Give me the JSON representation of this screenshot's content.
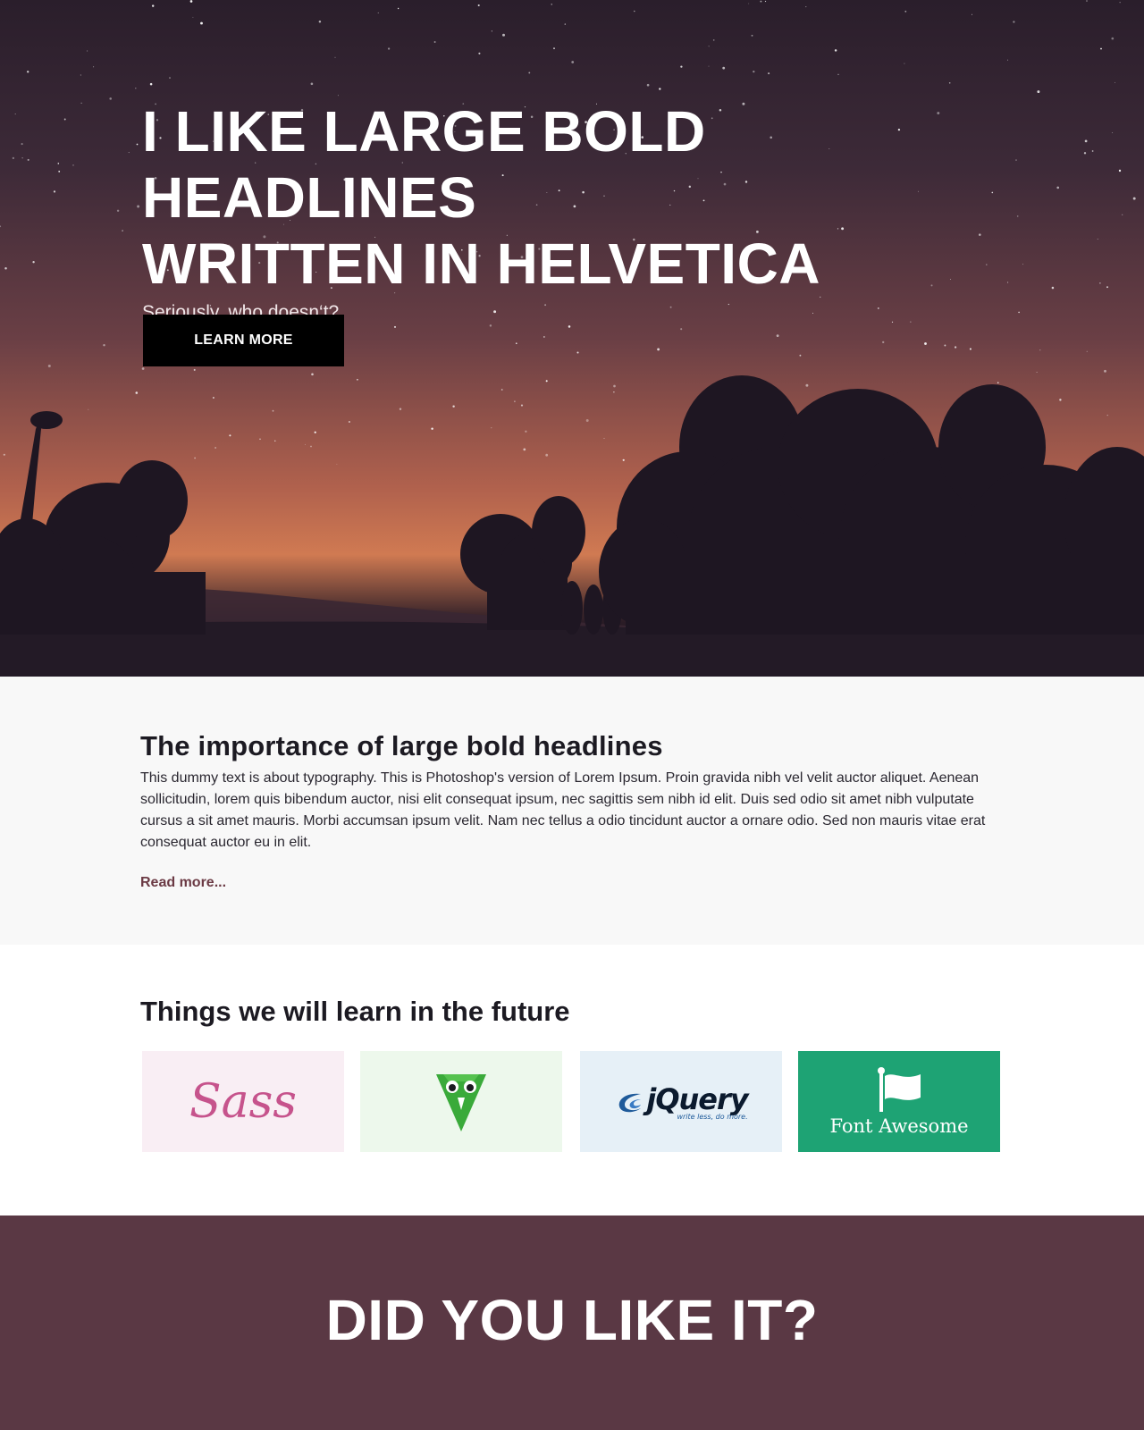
{
  "hero": {
    "title_line1": "I LIKE LARGE BOLD HEADLINES",
    "title_line2": "WRITTEN IN HELVETICA",
    "subtitle": "Seriously, who doesn‘t?",
    "button_label": "LEARN MORE"
  },
  "article": {
    "heading": "The importance of large bold headlines",
    "body": "This dummy text is about typography. This is Photoshop's version  of Lorem Ipsum. Proin gravida nibh vel velit auctor aliquet. Aenean sollicitudin, lorem quis bibendum auctor, nisi elit consequat ipsum, nec sagittis sem nibh id elit. Duis sed odio sit amet nibh vulputate cursus a sit amet mauris. Morbi accumsan ipsum velit. Nam nec tellus a odio tincidunt auctor a ornare odio. Sed non  mauris vitae erat consequat auctor eu in elit.",
    "read_more": "Read more..."
  },
  "future": {
    "heading": "Things we will learn in the future",
    "tiles": [
      {
        "name": "sass",
        "label": "Sass",
        "bg": "#f9eef4",
        "icon": "sass-logo"
      },
      {
        "name": "bourbon",
        "label": "",
        "bg": "#edf8ec",
        "icon": "bourbon-owl-logo"
      },
      {
        "name": "jquery",
        "label": "jQuery",
        "tagline": "write less, do more.",
        "bg": "#e6f0f7",
        "icon": "jquery-logo"
      },
      {
        "name": "font-awesome",
        "label": "Font Awesome",
        "bg": "#1ea374",
        "icon": "flag-icon"
      }
    ]
  },
  "cta": {
    "heading": "DID YOU LIKE IT?",
    "bg": "#5a3844"
  }
}
